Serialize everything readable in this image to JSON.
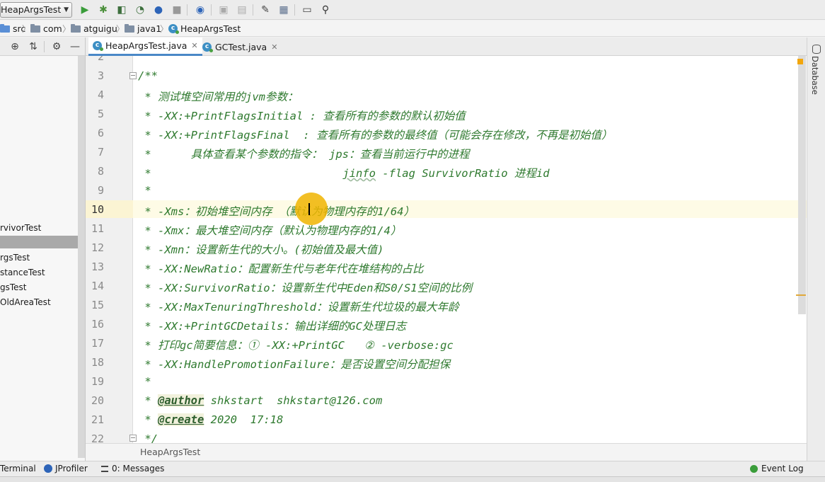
{
  "toolbar": {
    "run_config": "HeapArgsTest",
    "icons": [
      "run-icon",
      "debug-icon",
      "coverage-icon",
      "profile-icon",
      "jprofiler-icon",
      "stop-icon",
      "update-icon",
      "build-icon",
      "rebuild-icon",
      "settings-wrench-icon",
      "project-structure-icon",
      "terminal-icon",
      "search-icon"
    ]
  },
  "breadcrumb": {
    "items": [
      "src",
      "com",
      "atguigu",
      "java1",
      "HeapArgsTest"
    ]
  },
  "project_tree": {
    "items": [
      "rvivorTest",
      "",
      "rgsTest",
      "stanceTest",
      "gsTest",
      "OldAreaTest"
    ]
  },
  "tabs": [
    {
      "label": "HeapArgsTest.java",
      "active": true
    },
    {
      "label": "GCTest.java",
      "active": false
    }
  ],
  "editor": {
    "current_line": 10,
    "lines": [
      {
        "n": "2",
        "text": ""
      },
      {
        "n": "3",
        "text": "/**"
      },
      {
        "n": "4",
        "text": " * 测试堆空间常用的jvm参数："
      },
      {
        "n": "5",
        "text": " * -XX:+PrintFlagsInitial : 查看所有的参数的默认初始值"
      },
      {
        "n": "6",
        "text": " * -XX:+PrintFlagsFinal  : 查看所有的参数的最终值（可能会存在修改，不再是初始值）"
      },
      {
        "n": "7",
        "text": " *      具体查看某个参数的指令： jps：查看当前运行中的进程"
      },
      {
        "n": "8",
        "text": " *                             jinfo -flag SurvivorRatio 进程id"
      },
      {
        "n": "9",
        "text": " *"
      },
      {
        "n": "10",
        "text": " * -Xms：初始堆空间内存 （默认为物理内存的1/64）"
      },
      {
        "n": "11",
        "text": " * -Xmx：最大堆空间内存（默认为物理内存的1/4）"
      },
      {
        "n": "12",
        "text": " * -Xmn：设置新生代的大小。(初始值及最大值)"
      },
      {
        "n": "13",
        "text": " * -XX:NewRatio：配置新生代与老年代在堆结构的占比"
      },
      {
        "n": "14",
        "text": " * -XX:SurvivorRatio：设置新生代中Eden和S0/S1空间的比例"
      },
      {
        "n": "15",
        "text": " * -XX:MaxTenuringThreshold：设置新生代垃圾的最大年龄"
      },
      {
        "n": "16",
        "text": " * -XX:+PrintGCDetails：输出详细的GC处理日志"
      },
      {
        "n": "17",
        "text": " * 打印gc简要信息：① -XX:+PrintGC   ② -verbose:gc"
      },
      {
        "n": "18",
        "text": " * -XX:HandlePromotionFailure：是否设置空间分配担保"
      },
      {
        "n": "19",
        "text": " *"
      },
      {
        "n": "20",
        "text": " * @author shkstart  shkstart@126.com"
      },
      {
        "n": "21",
        "text": " * @create 2020  17:18"
      },
      {
        "n": "22",
        "text": " */"
      }
    ],
    "footer": "HeapArgsTest"
  },
  "right_strip": {
    "label": "Database"
  },
  "bottom_bar": {
    "terminal": "Terminal",
    "jprofiler": "JProfiler",
    "messages": "0: Messages",
    "event_log": "Event Log"
  },
  "colors": {
    "comment_green": "#2f7a2f",
    "current_line": "#fefbe6",
    "tab_underline": "#4a88c7",
    "marker": "#f2a60c"
  }
}
